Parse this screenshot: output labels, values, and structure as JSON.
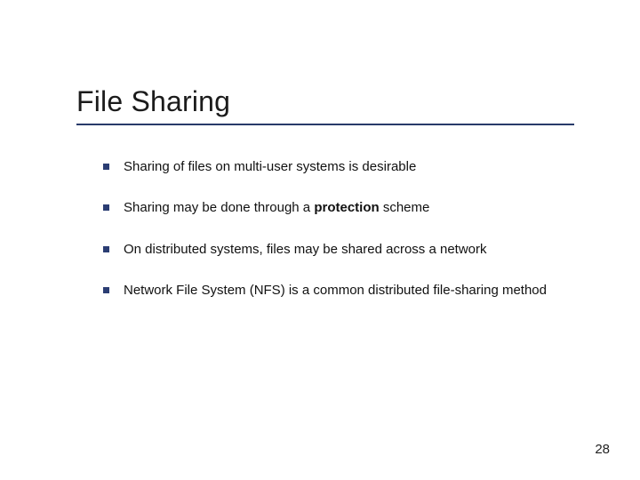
{
  "slide": {
    "title": "File Sharing",
    "page_number": "28",
    "accent_color": "#2b3d73"
  },
  "bullets": [
    {
      "text": "Sharing of files on multi-user systems is desirable"
    },
    {
      "text_pre": "Sharing may be done through a ",
      "bold": "protection",
      "text_post": " scheme"
    },
    {
      "text": "On distributed systems, files may be shared across a network"
    },
    {
      "text": "Network File System (NFS) is a common distributed file-sharing method"
    }
  ]
}
